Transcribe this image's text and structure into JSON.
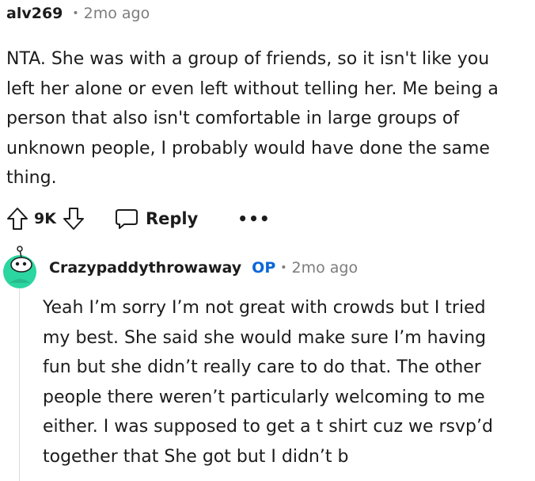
{
  "comment": {
    "username": "alv269",
    "separator": "•",
    "time": "2mo ago",
    "body_lines": [
      "NTA. She was with a group of friends, so it isn't like you",
      "left her alone or even left without telling her. Me being a",
      "person that also isn't comfortable in large groups of",
      "unknown people, I probably would have done the same",
      "thing."
    ],
    "vote_count": "9K",
    "reply_label": "Reply",
    "more_label": "•••"
  },
  "reply": {
    "username": "Crazypaddythrowaway",
    "op_badge": "OP",
    "separator": "•",
    "time": "2mo ago",
    "body_lines": [
      "Yeah I’m sorry I’m not great with crowds but I tried",
      "my best. She said she would make sure I’m having",
      "fun but she didn’t really care to do that. The other",
      "people there weren’t particularly welcoming to me",
      "either. I was supposed to get a t shirt cuz we rsvp’d",
      "together that She got but I didn’t b"
    ]
  },
  "icons": {
    "upvote": "arrow-up-icon",
    "downvote": "arrow-down-icon",
    "reply": "speech-bubble-icon",
    "more": "ellipsis-icon",
    "avatar": "snoo-avatar-icon"
  },
  "colors": {
    "text": "#1c1c1c",
    "muted": "#7c7c7c",
    "op": "#0a66d8",
    "avatar": "#2bd6a0"
  }
}
